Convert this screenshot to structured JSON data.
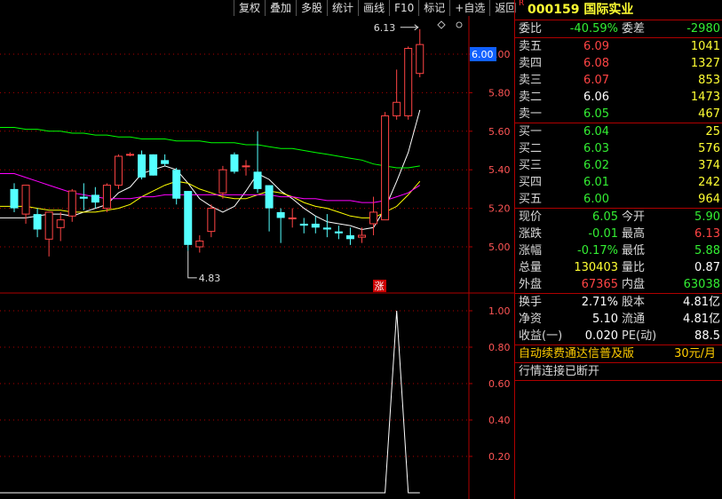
{
  "toolbar": [
    "复权",
    "叠加",
    "多股",
    "统计",
    "画线",
    "F10",
    "标记",
    "+自选",
    "返回"
  ],
  "stock": {
    "r_badge": "R",
    "code_name": "000159 国际实业"
  },
  "weibi": {
    "label": "委比",
    "value": "-40.59%",
    "label2": "委差",
    "value2": "-2980"
  },
  "asks": [
    {
      "label": "卖五",
      "price": "6.09",
      "vol": "1041"
    },
    {
      "label": "卖四",
      "price": "6.08",
      "vol": "1327"
    },
    {
      "label": "卖三",
      "price": "6.07",
      "vol": "853"
    },
    {
      "label": "卖二",
      "price": "6.06",
      "vol": "1473"
    },
    {
      "label": "卖一",
      "price": "6.05",
      "vol": "467"
    }
  ],
  "bids": [
    {
      "label": "买一",
      "price": "6.04",
      "vol": "25"
    },
    {
      "label": "买二",
      "price": "6.03",
      "vol": "576"
    },
    {
      "label": "买三",
      "price": "6.02",
      "vol": "374"
    },
    {
      "label": "买四",
      "price": "6.01",
      "vol": "242"
    },
    {
      "label": "买五",
      "price": "6.00",
      "vol": "964"
    }
  ],
  "stats": [
    {
      "l1": "现价",
      "v1": "6.05",
      "l2": "今开",
      "v2": "5.90"
    },
    {
      "l1": "涨跌",
      "v1": "-0.01",
      "l2": "最高",
      "v2": "6.13"
    },
    {
      "l1": "涨幅",
      "v1": "-0.17%",
      "l2": "最低",
      "v2": "5.88"
    },
    {
      "l1": "总量",
      "v1": "130403",
      "l2": "量比",
      "v2": "0.87"
    },
    {
      "l1": "外盘",
      "v1": "67365",
      "l2": "内盘",
      "v2": "63038"
    }
  ],
  "fund": [
    {
      "l1": "换手",
      "v1": "2.71%",
      "l2": "股本",
      "v2": "4.81亿"
    },
    {
      "l1": "净资",
      "v1": "5.10",
      "l2": "流通",
      "v2": "4.81亿"
    },
    {
      "l1": "收益(一)",
      "v1": "0.020",
      "l2": "PE(动)",
      "v2": "88.5"
    }
  ],
  "ad": {
    "text": "自动续费通达信普及版",
    "price": "30元/月"
  },
  "status_text": "行情连接已断开",
  "colors": {
    "up": "#ff4444",
    "down": "#54ffff",
    "ma5": "#ffffff",
    "ma10": "#ffff00",
    "ma20": "#ff00ff",
    "ma60": "#00ff00",
    "grid": "#b00000"
  },
  "chart_data": {
    "type": "candlestick",
    "price_axis": {
      "ticks": [
        "6.00",
        "5.80",
        "5.60",
        "5.40",
        "5.20",
        "5.00"
      ],
      "ylim": [
        4.83,
        6.13
      ]
    },
    "current_price_tag": "6.00",
    "high_label": "6.13",
    "low_label": "4.83",
    "limit_up_marker": "涨",
    "candles": [
      {
        "o": 5.3,
        "h": 5.33,
        "l": 5.18,
        "c": 5.2
      },
      {
        "o": 5.17,
        "h": 5.26,
        "l": 5.12,
        "c": 5.32
      },
      {
        "o": 5.17,
        "h": 5.2,
        "l": 5.05,
        "c": 5.09
      },
      {
        "o": 5.04,
        "h": 5.16,
        "l": 4.95,
        "c": 5.18
      },
      {
        "o": 5.1,
        "h": 5.18,
        "l": 5.03,
        "c": 5.14
      },
      {
        "o": 5.16,
        "h": 5.3,
        "l": 5.13,
        "c": 5.29
      },
      {
        "o": 5.26,
        "h": 5.33,
        "l": 5.19,
        "c": 5.25
      },
      {
        "o": 5.27,
        "h": 5.31,
        "l": 5.2,
        "c": 5.23
      },
      {
        "o": 5.2,
        "h": 5.33,
        "l": 5.18,
        "c": 5.32
      },
      {
        "o": 5.32,
        "h": 5.48,
        "l": 5.3,
        "c": 5.47
      },
      {
        "o": 5.48,
        "h": 5.49,
        "l": 5.47,
        "c": 5.48
      },
      {
        "o": 5.48,
        "h": 5.5,
        "l": 5.35,
        "c": 5.36
      },
      {
        "o": 5.48,
        "h": 5.48,
        "l": 5.37,
        "c": 5.37
      },
      {
        "o": 5.45,
        "h": 5.48,
        "l": 5.42,
        "c": 5.43
      },
      {
        "o": 5.4,
        "h": 5.41,
        "l": 5.22,
        "c": 5.25
      },
      {
        "o": 5.29,
        "h": 5.29,
        "l": 4.98,
        "c": 5.01
      },
      {
        "o": 5.0,
        "h": 5.06,
        "l": 4.97,
        "c": 5.03
      },
      {
        "o": 5.08,
        "h": 5.22,
        "l": 5.05,
        "c": 5.2
      },
      {
        "o": 5.28,
        "h": 5.42,
        "l": 5.25,
        "c": 5.4
      },
      {
        "o": 5.48,
        "h": 5.49,
        "l": 5.38,
        "c": 5.39
      },
      {
        "o": 5.42,
        "h": 5.45,
        "l": 5.37,
        "c": 5.42
      },
      {
        "o": 5.39,
        "h": 5.6,
        "l": 5.28,
        "c": 5.3
      },
      {
        "o": 5.32,
        "h": 5.32,
        "l": 5.08,
        "c": 5.2
      },
      {
        "o": 5.18,
        "h": 5.2,
        "l": 5.02,
        "c": 5.15
      },
      {
        "o": 5.15,
        "h": 5.2,
        "l": 5.1,
        "c": 5.15
      },
      {
        "o": 5.12,
        "h": 5.15,
        "l": 5.07,
        "c": 5.11
      },
      {
        "o": 5.12,
        "h": 5.16,
        "l": 5.07,
        "c": 5.1
      },
      {
        "o": 5.1,
        "h": 5.17,
        "l": 5.05,
        "c": 5.09
      },
      {
        "o": 5.08,
        "h": 5.11,
        "l": 5.04,
        "c": 5.07
      },
      {
        "o": 5.06,
        "h": 5.1,
        "l": 5.01,
        "c": 5.04
      },
      {
        "o": 5.05,
        "h": 5.1,
        "l": 5.02,
        "c": 5.06
      },
      {
        "o": 5.12,
        "h": 5.26,
        "l": 5.06,
        "c": 5.18
      },
      {
        "o": 5.14,
        "h": 5.7,
        "l": 5.14,
        "c": 5.68
      },
      {
        "o": 5.68,
        "h": 5.92,
        "l": 5.66,
        "c": 5.75
      },
      {
        "o": 5.68,
        "h": 6.04,
        "l": 5.66,
        "c": 6.03
      },
      {
        "o": 5.9,
        "h": 6.13,
        "l": 5.88,
        "c": 6.05
      }
    ],
    "ma": [
      {
        "name": "MA5",
        "values": [
          5.15,
          5.15,
          5.16,
          5.17,
          5.17,
          5.16,
          5.18,
          5.2,
          5.22,
          5.28,
          5.31,
          5.38,
          5.4,
          5.42,
          5.4,
          5.33,
          5.25,
          5.21,
          5.18,
          5.21,
          5.29,
          5.38,
          5.35,
          5.29,
          5.25,
          5.2,
          5.16,
          5.13,
          5.12,
          5.11,
          5.09,
          5.1,
          5.2,
          5.34,
          5.49,
          5.71
        ]
      },
      {
        "name": "MA10",
        "values": [
          5.21,
          5.21,
          5.2,
          5.19,
          5.19,
          5.18,
          5.18,
          5.18,
          5.19,
          5.2,
          5.22,
          5.26,
          5.29,
          5.32,
          5.34,
          5.33,
          5.3,
          5.28,
          5.26,
          5.25,
          5.25,
          5.27,
          5.29,
          5.28,
          5.26,
          5.23,
          5.21,
          5.2,
          5.18,
          5.16,
          5.15,
          5.15,
          5.18,
          5.21,
          5.27,
          5.34
        ]
      },
      {
        "name": "MA20",
        "values": [
          5.38,
          5.36,
          5.34,
          5.32,
          5.3,
          5.28,
          5.27,
          5.26,
          5.25,
          5.25,
          5.25,
          5.26,
          5.26,
          5.27,
          5.27,
          5.27,
          5.27,
          5.27,
          5.27,
          5.27,
          5.27,
          5.27,
          5.27,
          5.26,
          5.26,
          5.25,
          5.25,
          5.24,
          5.24,
          5.24,
          5.23,
          5.23,
          5.24,
          5.26,
          5.28,
          5.32
        ]
      },
      {
        "name": "MA60",
        "values": [
          5.62,
          5.61,
          5.61,
          5.6,
          5.6,
          5.59,
          5.59,
          5.58,
          5.58,
          5.57,
          5.57,
          5.56,
          5.56,
          5.56,
          5.55,
          5.55,
          5.55,
          5.54,
          5.54,
          5.54,
          5.53,
          5.53,
          5.52,
          5.51,
          5.51,
          5.5,
          5.49,
          5.48,
          5.47,
          5.46,
          5.45,
          5.43,
          5.42,
          5.41,
          5.41,
          5.42
        ]
      }
    ],
    "indicator": {
      "ticks": [
        "1.00",
        "0.80",
        "0.60",
        "0.40",
        "0.20"
      ],
      "ylim": [
        0,
        1
      ],
      "values": [
        0,
        0,
        0,
        0,
        0,
        0,
        0,
        0,
        0,
        0,
        0,
        0,
        0,
        0,
        0,
        0,
        0,
        0,
        0,
        0,
        0,
        0,
        0,
        0,
        0,
        0,
        0,
        0,
        0,
        0,
        0,
        0,
        0,
        1,
        0,
        0
      ]
    }
  }
}
